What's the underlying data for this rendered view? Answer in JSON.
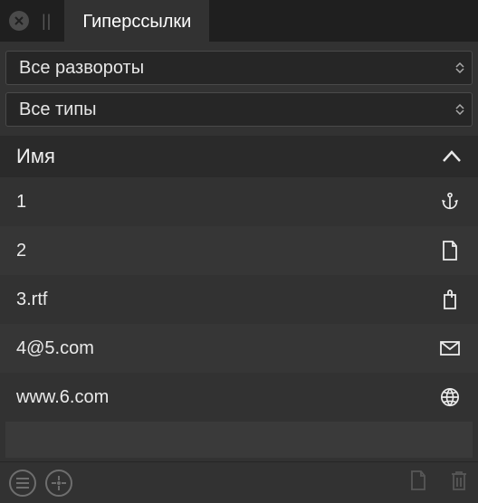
{
  "tab": {
    "title": "Гиперссылки"
  },
  "filters": {
    "spreads": "Все развороты",
    "types": "Все типы"
  },
  "columns": {
    "name": "Имя",
    "sort": "asc"
  },
  "rows": [
    {
      "label": "1",
      "icon": "anchor-icon"
    },
    {
      "label": "2",
      "icon": "file-icon"
    },
    {
      "label": "3.rtf",
      "icon": "attachment-icon"
    },
    {
      "label": "4@5.com",
      "icon": "mail-icon"
    },
    {
      "label": "www.6.com",
      "icon": "globe-icon"
    }
  ],
  "footer": {
    "menu": "menu-icon",
    "target": "target-icon",
    "new": "new-file-icon",
    "delete": "trash-icon"
  },
  "colors": {
    "bg": "#323232",
    "bgDark": "#1f1f1f",
    "border": "#4a4a4a",
    "text": "#e8e8e8",
    "muted": "#6e6e6e"
  }
}
